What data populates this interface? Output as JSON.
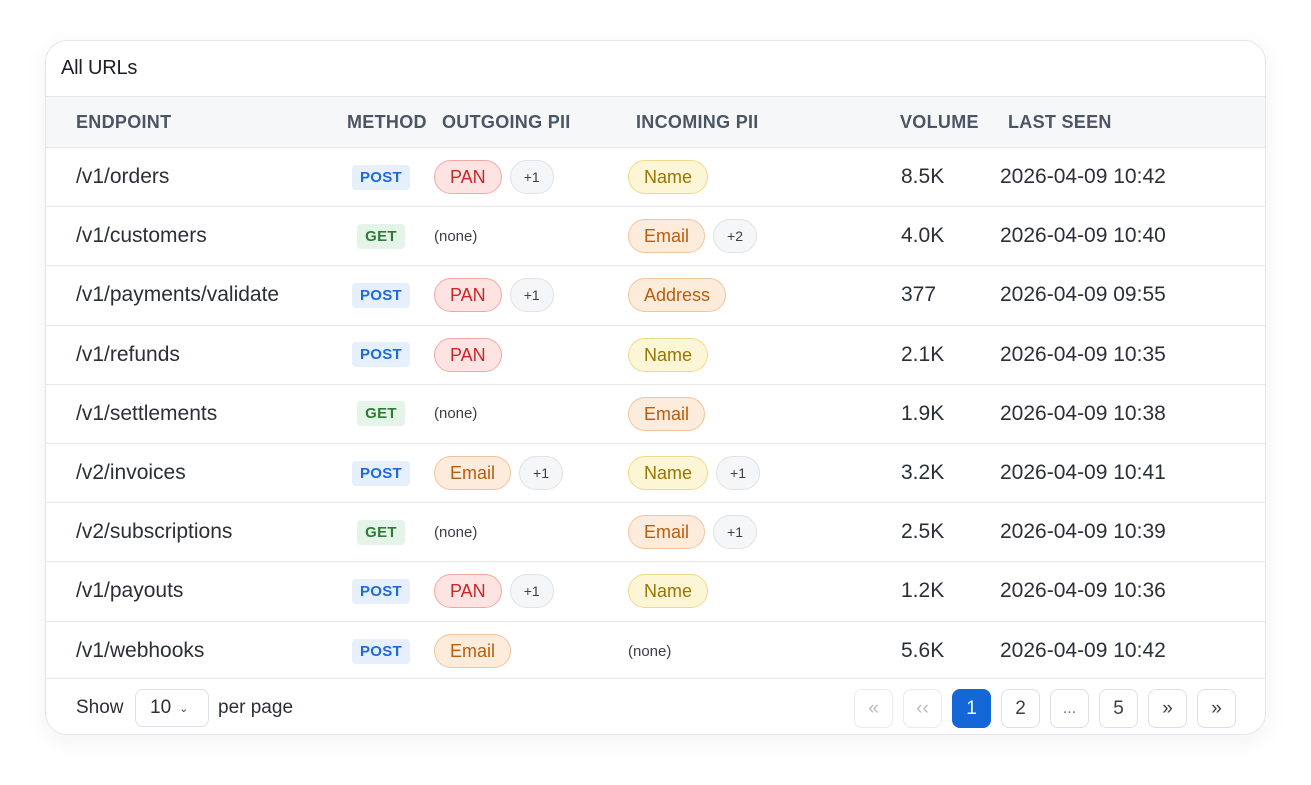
{
  "card_title": "All URLs",
  "columns": {
    "endpoint": "ENDPOINT",
    "method": "METHOD",
    "outgoing": "OUTGOING PII",
    "incoming": "INCOMING PII",
    "volume": "VOLUME",
    "last_seen": "LAST SEEN"
  },
  "rows": [
    {
      "endpoint": "/v1/orders",
      "method": "POST",
      "out_tag": "PAN",
      "out_more": "+1",
      "out_none": "",
      "in_tag": "Name",
      "in_more": "",
      "in_none": "",
      "volume": "8.5K",
      "last_seen": "2026-04-09 10:42"
    },
    {
      "endpoint": "/v1/customers",
      "method": "GET",
      "out_tag": "",
      "out_more": "",
      "out_none": "(none)",
      "in_tag": "Email",
      "in_more": "+2",
      "in_none": "",
      "volume": "4.0K",
      "last_seen": "2026-04-09 10:40"
    },
    {
      "endpoint": "/v1/payments/validate",
      "method": "POST",
      "out_tag": "PAN",
      "out_more": "+1",
      "out_none": "",
      "in_tag": "Address",
      "in_more": "",
      "in_none": "",
      "volume": "377",
      "last_seen": "2026-04-09 09:55"
    },
    {
      "endpoint": "/v1/refunds",
      "method": "POST",
      "out_tag": "PAN",
      "out_more": "",
      "out_none": "",
      "in_tag": "Name",
      "in_more": "",
      "in_none": "",
      "volume": "2.1K",
      "last_seen": "2026-04-09 10:35"
    },
    {
      "endpoint": "/v1/settlements",
      "method": "GET",
      "out_tag": "",
      "out_more": "",
      "out_none": "(none)",
      "in_tag": "Email",
      "in_more": "",
      "in_none": "",
      "volume": "1.9K",
      "last_seen": "2026-04-09 10:38"
    },
    {
      "endpoint": "/v2/invoices",
      "method": "POST",
      "out_tag": "Email",
      "out_more": "+1",
      "out_none": "",
      "in_tag": "Name",
      "in_more": "+1",
      "in_none": "",
      "volume": "3.2K",
      "last_seen": "2026-04-09 10:41"
    },
    {
      "endpoint": "/v2/subscriptions",
      "method": "GET",
      "out_tag": "",
      "out_more": "",
      "out_none": "(none)",
      "in_tag": "Email",
      "in_more": "+1",
      "in_none": "",
      "volume": "2.5K",
      "last_seen": "2026-04-09 10:39"
    },
    {
      "endpoint": "/v1/payouts",
      "method": "POST",
      "out_tag": "PAN",
      "out_more": "+1",
      "out_none": "",
      "in_tag": "Name",
      "in_more": "",
      "in_none": "",
      "volume": "1.2K",
      "last_seen": "2026-04-09 10:36"
    },
    {
      "endpoint": "/v1/webhooks",
      "method": "POST",
      "out_tag": "Email",
      "out_more": "",
      "out_none": "",
      "in_tag": "",
      "in_more": "",
      "in_none": "(none)",
      "volume": "5.6K",
      "last_seen": "2026-04-09 10:42"
    }
  ],
  "footer": {
    "show_label": "Show",
    "per_page_value": "10",
    "per_page_label": "per page",
    "pages": [
      {
        "label": "«",
        "state": "disabled",
        "name": "first-page-button"
      },
      {
        "label": "‹‹",
        "state": "disabled",
        "name": "prev-page-button"
      },
      {
        "label": "1",
        "state": "active",
        "name": "page-1-button"
      },
      {
        "label": "2",
        "state": "normal",
        "name": "page-2-button"
      },
      {
        "label": "...",
        "state": "ellipsis",
        "name": "pagination-ellipsis"
      },
      {
        "label": "5",
        "state": "normal",
        "name": "page-5-button"
      },
      {
        "label": "»",
        "state": "normal",
        "name": "next-page-button"
      },
      {
        "label": "»",
        "state": "normal",
        "name": "last-page-button"
      }
    ]
  },
  "colors": {
    "accent": "#1467d6",
    "post": "#1d6ad8",
    "get": "#2e7d32",
    "pan": "#c62828",
    "email": "#b85c0d",
    "name": "#9a7400"
  }
}
